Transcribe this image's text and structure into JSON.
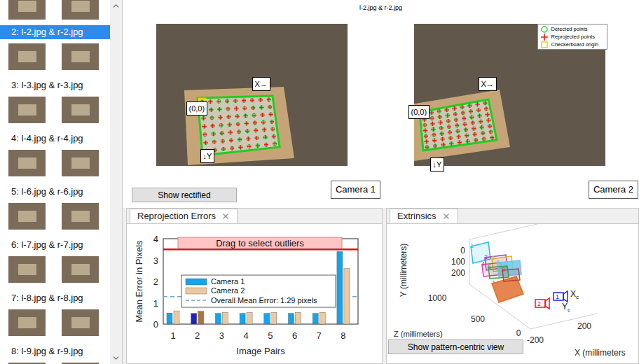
{
  "window": {
    "title": "l-2.jpg & r-2.jpg"
  },
  "sidebar": {
    "items": [
      {
        "label": "2: l-2.jpg & r-2.jpg",
        "selected": true
      },
      {
        "label": "3: l-3.jpg & r-3.jpg",
        "selected": false
      },
      {
        "label": "4: l-4.jpg & r-4.jpg",
        "selected": false
      },
      {
        "label": "5: l-6.jpg & r-6.jpg",
        "selected": false
      },
      {
        "label": "6: l-7.jpg & r-7.jpg",
        "selected": false
      },
      {
        "label": "7: l-8.jpg & r-8.jpg",
        "selected": false
      },
      {
        "label": "8: l-9.jpg & r-9.jpg",
        "selected": false
      }
    ]
  },
  "views": [
    {
      "camera": "Camera 1",
      "origin_label": "(0,0)",
      "x_label": "X→",
      "y_label": "↓Y",
      "show_legend": false
    },
    {
      "camera": "Camera 2",
      "origin_label": "(0,0)",
      "x_label": "X→",
      "y_label": "↓Y",
      "show_legend": true
    }
  ],
  "image_legend": [
    {
      "label": "Detected points",
      "kind": "circle",
      "color": "#22cc22"
    },
    {
      "label": "Reprojected points",
      "kind": "plus",
      "color": "#ee1111"
    },
    {
      "label": "Checkerboard origin",
      "kind": "square",
      "color": "#e8d800"
    }
  ],
  "buttons": {
    "rectified": "Show rectified",
    "pattern_view": "Show pattern-centric view"
  },
  "reprojection": {
    "tab": "Reprojection Errors",
    "y_axis": "Mean Error in Pixels",
    "x_axis": "Image Pairs",
    "y_ticks": [
      "0",
      "1",
      "2",
      "3",
      "4"
    ],
    "x_ticks": [
      {
        "label": "1",
        "selected": false
      },
      {
        "label": "2",
        "selected": true
      },
      {
        "label": "3",
        "selected": false
      },
      {
        "label": "4",
        "selected": false
      },
      {
        "label": "5",
        "selected": false
      },
      {
        "label": "6",
        "selected": false
      },
      {
        "label": "7",
        "selected": false
      },
      {
        "label": "8",
        "selected": false
      }
    ],
    "series": [
      {
        "name": "Camera 1",
        "color": "#12a5ee",
        "values": [
          0.52,
          0.5,
          0.5,
          0.5,
          0.5,
          0.5,
          0.5,
          3.4
        ]
      },
      {
        "name": "Camera 2",
        "color": "#ecc9a0",
        "values": [
          0.62,
          0.6,
          0.55,
          0.55,
          0.55,
          0.55,
          0.55,
          2.6
        ]
      }
    ],
    "overall_mean": 1.29,
    "mean_label": "Overall Mean Error: 1.29 pixels",
    "outlier_threshold": 3.5,
    "outlier_hint": "Drag to select outliers"
  },
  "extrinsics": {
    "tab": "Extrinsics",
    "y_axis": "Y (millimeters)",
    "z_axis": "Z (millimeters)",
    "x_axis": "X (millimeters",
    "y_ticks": [
      "0",
      "100",
      "200"
    ],
    "z_ticks": [
      "1000",
      "500",
      "0"
    ],
    "x_ticks": [
      "200",
      "-200"
    ],
    "cameras": [
      {
        "label": "1",
        "color": "#2020ff"
      },
      {
        "label": "2",
        "color": "#ff1010"
      }
    ],
    "camera_axes": [
      {
        "label": "X",
        "sub": "c"
      },
      {
        "label": "Y",
        "sub": "c"
      }
    ],
    "boards": [
      {
        "label": "1",
        "color": "#2fb8ee",
        "filled": false
      },
      {
        "label": "2",
        "color": "#a040c0",
        "filled": false
      },
      {
        "label": "3",
        "color": "#d8b820",
        "filled": false
      },
      {
        "label": "4",
        "color": "#d040a0",
        "filled": false
      },
      {
        "label": "5",
        "color": "#70c8f0",
        "filled": true
      },
      {
        "label": "6",
        "color": "#40a040",
        "filled": false
      },
      {
        "label": "7",
        "color": "#e07030",
        "filled": true
      },
      {
        "label": "8",
        "color": "#c04040",
        "filled": false
      }
    ]
  }
}
